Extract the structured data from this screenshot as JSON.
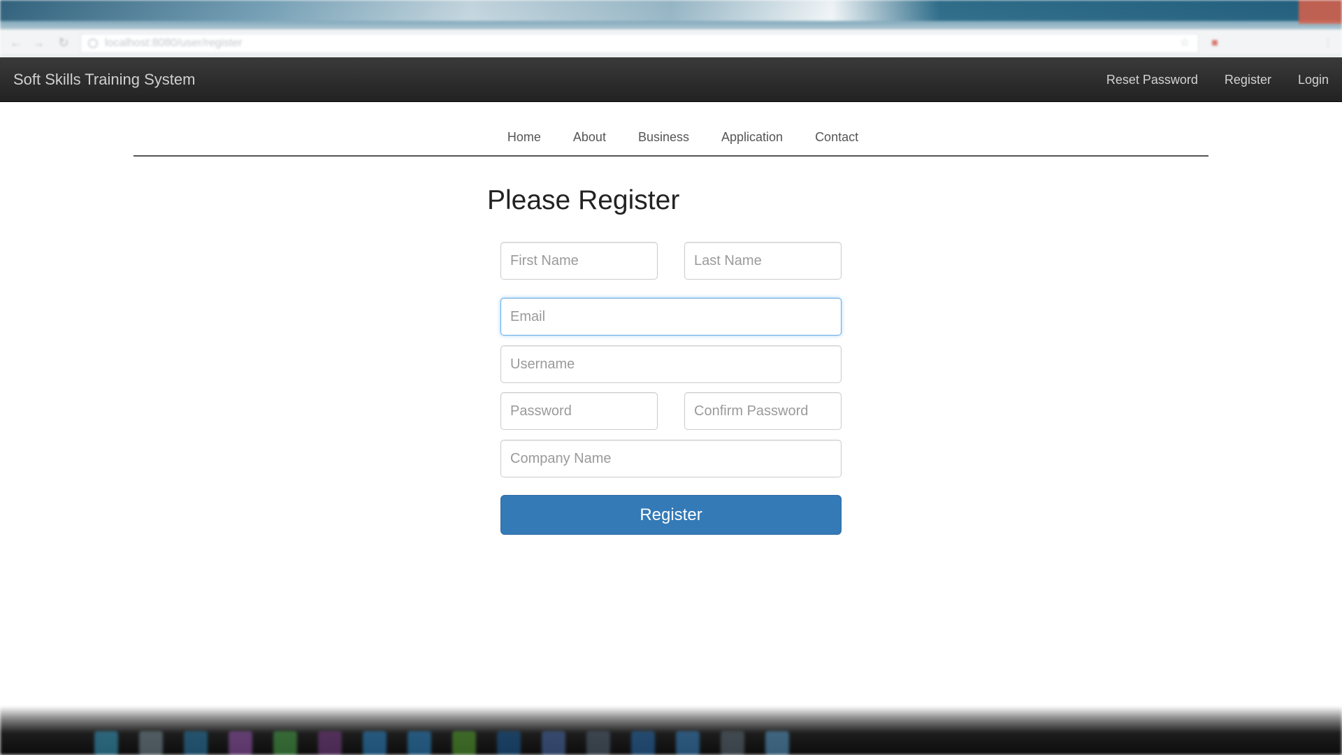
{
  "browser": {
    "address": "localhost:8080/user/register",
    "colors": {
      "tab_strip": "#2f5f7a",
      "close": "#d9604a",
      "toolbar": "#f2f4f5"
    },
    "icons": [
      "back-arrow-icon",
      "forward-arrow-icon",
      "reload-icon",
      "info-icon",
      "star-icon",
      "extension-icon",
      "menu-icon"
    ]
  },
  "navbar": {
    "brand": "Soft Skills Training System",
    "links": [
      "Reset Password",
      "Register",
      "Login"
    ],
    "colors": {
      "background": "#222222",
      "text": "#d3d3d3"
    }
  },
  "subnav": {
    "items": [
      "Home",
      "About",
      "Business",
      "Application",
      "Contact"
    ]
  },
  "form": {
    "heading": "Please Register",
    "first_name_placeholder": "First Name",
    "last_name_placeholder": "Last Name",
    "email_placeholder": "Email",
    "username_placeholder": "Username",
    "password_placeholder": "Password",
    "confirm_password_placeholder": "Confirm Password",
    "company_name_placeholder": "Company Name",
    "submit_label": "Register",
    "focused_field": "email",
    "colors": {
      "button": "#337ab7",
      "focus_border": "#66afe9"
    }
  },
  "taskbar": {
    "icon_colors": [
      "#3aa0c8",
      "#7a8f99",
      "#2c7fb0",
      "#9b59b6",
      "#4aa84a",
      "#7b3f8a",
      "#2e8bcc",
      "#2e8bcc",
      "#5aa832",
      "#1d5f9a",
      "#4c6fb0",
      "#556677",
      "#2a6fb5",
      "#3a86c8",
      "#5f6f7a",
      "#5ba0d0"
    ]
  }
}
